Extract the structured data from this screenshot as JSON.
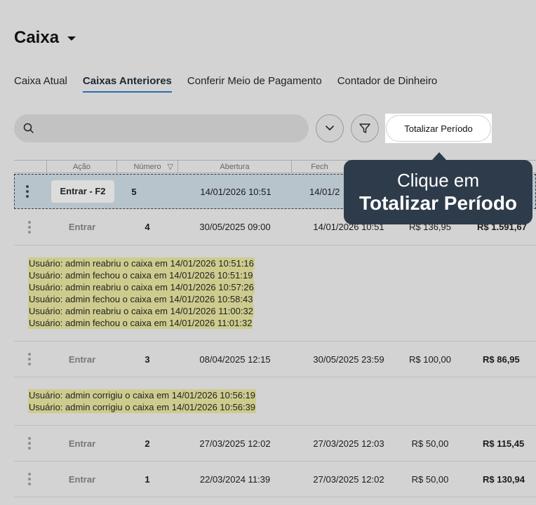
{
  "header": {
    "title": "Caixa"
  },
  "tabs": [
    {
      "label": "Caixa Atual"
    },
    {
      "label": "Caixas Anteriores"
    },
    {
      "label": "Conferir Meio de Pagamento"
    },
    {
      "label": "Contador de Dinheiro"
    }
  ],
  "toolbar": {
    "search_placeholder": "",
    "total_button": "Totalizar Período",
    "icons": {
      "search": "search-icon",
      "expand": "chevron-down-icon",
      "filter": "filter-icon"
    }
  },
  "table": {
    "columns": [
      "Ação",
      "Número",
      "Abertura",
      "Fech"
    ],
    "sort_icon": "▽",
    "rows": [
      {
        "action": "Entrar - F2",
        "number": "5",
        "opened": "14/01/2026 10:51",
        "closed": "14/01/2",
        "value1": "",
        "value2": ""
      },
      {
        "action": "Entrar",
        "number": "4",
        "opened": "30/05/2025 09:00",
        "closed": "14/01/2026 10:51",
        "value1": "R$ 136,95",
        "value2": "R$ 1.591,67"
      },
      {
        "action": "Entrar",
        "number": "3",
        "opened": "08/04/2025 12:15",
        "closed": "30/05/2025 23:59",
        "value1": "R$ 100,00",
        "value2": "R$ 86,95"
      },
      {
        "action": "Entrar",
        "number": "2",
        "opened": "27/03/2025 12:02",
        "closed": "27/03/2025 12:03",
        "value1": "R$ 50,00",
        "value2": "R$ 115,45"
      },
      {
        "action": "Entrar",
        "number": "1",
        "opened": "22/03/2024 11:39",
        "closed": "27/03/2025 12:02",
        "value1": "R$ 50,00",
        "value2": "R$ 130,94"
      }
    ],
    "logs_row4": [
      "Usuário: admin reabriu o caixa em 14/01/2026 10:51:16",
      "Usuário: admin fechou o caixa em 14/01/2026 10:51:19",
      "Usuário: admin reabriu o caixa em 14/01/2026 10:57:26",
      "Usuário: admin fechou o caixa em 14/01/2026 10:58:43",
      "Usuário: admin reabriu o caixa em 14/01/2026 11:00:32",
      "Usuário: admin fechou o caixa em 14/01/2026 11:01:32"
    ],
    "logs_row3": [
      "Usuário: admin corrigiu o caixa em 14/01/2026 10:56:19",
      "Usuário: admin corrigiu o caixa em 14/01/2026 10:56:39"
    ]
  },
  "tooltip": {
    "line1": "Clique em",
    "line2": "Totalizar Período"
  },
  "colors": {
    "tab_underline": "#2b6cb0",
    "tooltip_bg": "#2e3b4a",
    "log_highlight": "#cdcc8e",
    "selected_row": "#b8c4cc"
  }
}
